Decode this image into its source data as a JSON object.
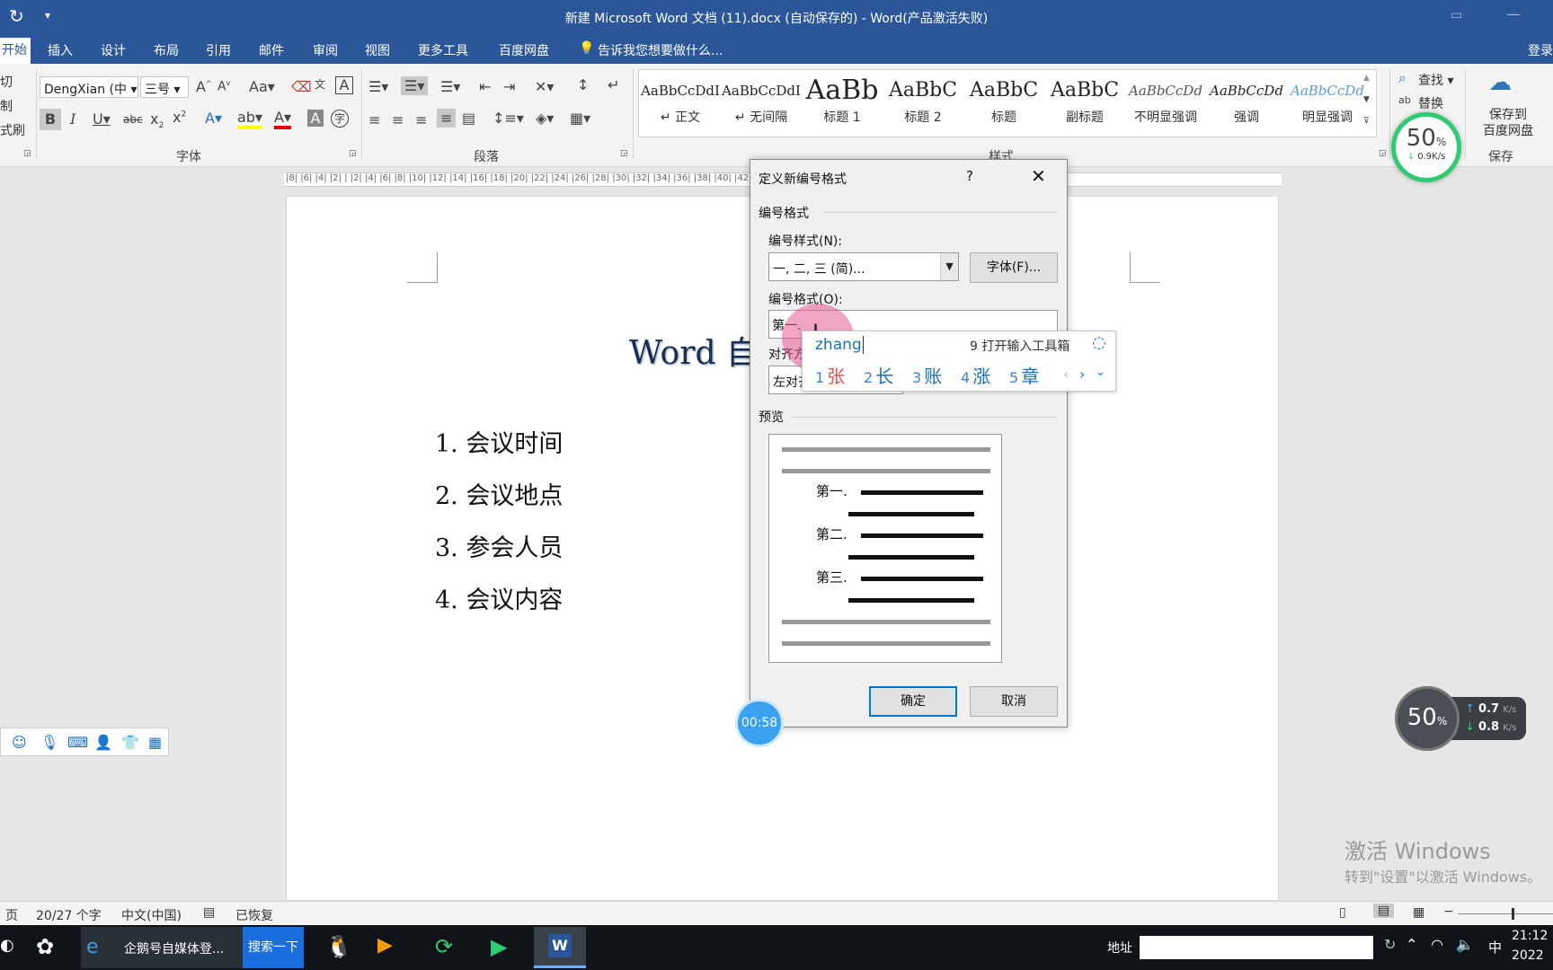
{
  "title": "新建 Microsoft Word 文档 (11).docx (自动保存的) - Word(产品激活失败)",
  "tabs": [
    "开始",
    "插入",
    "设计",
    "布局",
    "引用",
    "邮件",
    "审阅",
    "视图",
    "更多工具",
    "百度网盘"
  ],
  "tell_me": "告诉我您想要做什么...",
  "login": "登录",
  "clipboard": {
    "cut": "切",
    "copy": "制",
    "painter": "式刷"
  },
  "font": {
    "name": "DengXian (中",
    "size": "三号",
    "group": "字体",
    "aa": "Aa",
    "A": "A"
  },
  "paragraph": {
    "group": "段落"
  },
  "styles": {
    "group": "样式",
    "items": [
      {
        "sample": "AaBbCcDdI",
        "name": "↵ 正文"
      },
      {
        "sample": "AaBbCcDdI",
        "name": "↵ 无间隔"
      },
      {
        "sample": "AaBb",
        "name": "标题 1"
      },
      {
        "sample": "AaBbC",
        "name": "标题 2"
      },
      {
        "sample": "AaBbC",
        "name": "标题"
      },
      {
        "sample": "AaBbC",
        "name": "副标题"
      },
      {
        "sample": "AaBbCcDd",
        "name": "不明显强调"
      },
      {
        "sample": "AaBbCcDd",
        "name": "强调"
      },
      {
        "sample": "AaBbCcDd",
        "name": "明显强调"
      }
    ]
  },
  "editing": {
    "find": "查找",
    "replace": "替换"
  },
  "save": {
    "label": "保存到\n百度网盘",
    "group": "保存"
  },
  "speed_top": {
    "pct": "50",
    "unit": "%",
    "rate": "0.9K/s"
  },
  "ruler": "|8| |6| |4| |2| | |2| |4| |6| |8| |10| |12| |14| |16| |18| |20| |22| |24| |26| |28| |30| |32| |34| |36| |38| |40| |42| |44| |46| |48",
  "document": {
    "title": "Word 自",
    "items": [
      "1. 会议时间",
      "2. 会议地点",
      "3. 参会人员",
      "4. 会议内容"
    ]
  },
  "dialog": {
    "title": "定义新编号格式",
    "help": "?",
    "section_format": "编号格式",
    "style_label": "编号样式(N):",
    "style_value": "一, 二, 三 (简)...",
    "font_btn": "字体(F)...",
    "format_label": "编号格式(O):",
    "format_value": "第一.",
    "align_label": "对齐方",
    "align_value": "左对齐",
    "preview_label": "预览",
    "preview_items": [
      "第一.",
      "第二.",
      "第三."
    ],
    "ok": "确定",
    "cancel": "取消"
  },
  "ime": {
    "input": "zhang",
    "toolbox": "9 打开输入工具箱",
    "candidates": [
      {
        "n": "1",
        "c": "张"
      },
      {
        "n": "2",
        "c": "长"
      },
      {
        "n": "3",
        "c": "账"
      },
      {
        "n": "4",
        "c": "涨"
      },
      {
        "n": "5",
        "c": "章"
      }
    ]
  },
  "timer": "00:58",
  "speed_bottom": {
    "pct": "50",
    "unit": "%",
    "up": "0.7",
    "down": "0.8",
    "unit_rate": "K/s"
  },
  "status": {
    "page": "页",
    "words": "20/27 个字",
    "lang": "中文(中国)",
    "recovered": "已恢复"
  },
  "watermark": {
    "line1": "激活 Windows",
    "line2": "转到\"设置\"以激活 Windows。"
  },
  "taskbar": {
    "app1": "企鹅号自媒体登...",
    "search_btn": "搜索一下",
    "address": "地址",
    "ime": "中",
    "time": "21:12",
    "date": "2022"
  }
}
